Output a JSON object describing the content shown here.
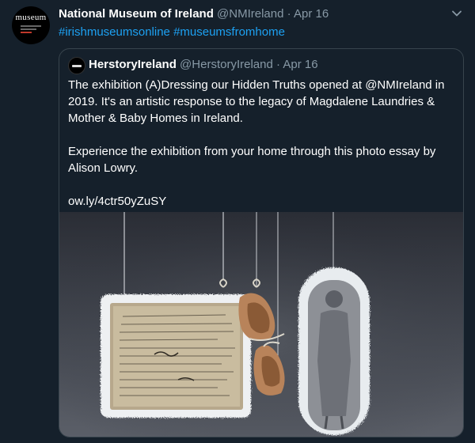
{
  "tweet": {
    "author_name": "National Museum of Ireland",
    "handle": "@NMIreland",
    "separator": "·",
    "date": "Apr 16",
    "hashtags": "#irishmuseumsonline #museumsfromhome",
    "avatar_text": "museum",
    "icons": {
      "menu": "chevron-down-icon"
    }
  },
  "quoted": {
    "author_name": "HerstoryIreland",
    "handle": "@HerstoryIreland",
    "separator": "·",
    "date": "Apr 16",
    "paragraph1": "The exhibition (A)Dressing our Hidden Truths opened at @NMIreland in 2019. It's an artistic response to the legacy of Magdalene Laundries & Mother & Baby Homes in Ireland.",
    "paragraph2": "Experience the exhibition from your home through this photo essay by Alison Lowry.",
    "link": "ow.ly/4ctr50yZuSY"
  },
  "colors": {
    "background": "#15202b",
    "link": "#1da1f2",
    "muted": "#8899a6",
    "border": "#38444d"
  }
}
